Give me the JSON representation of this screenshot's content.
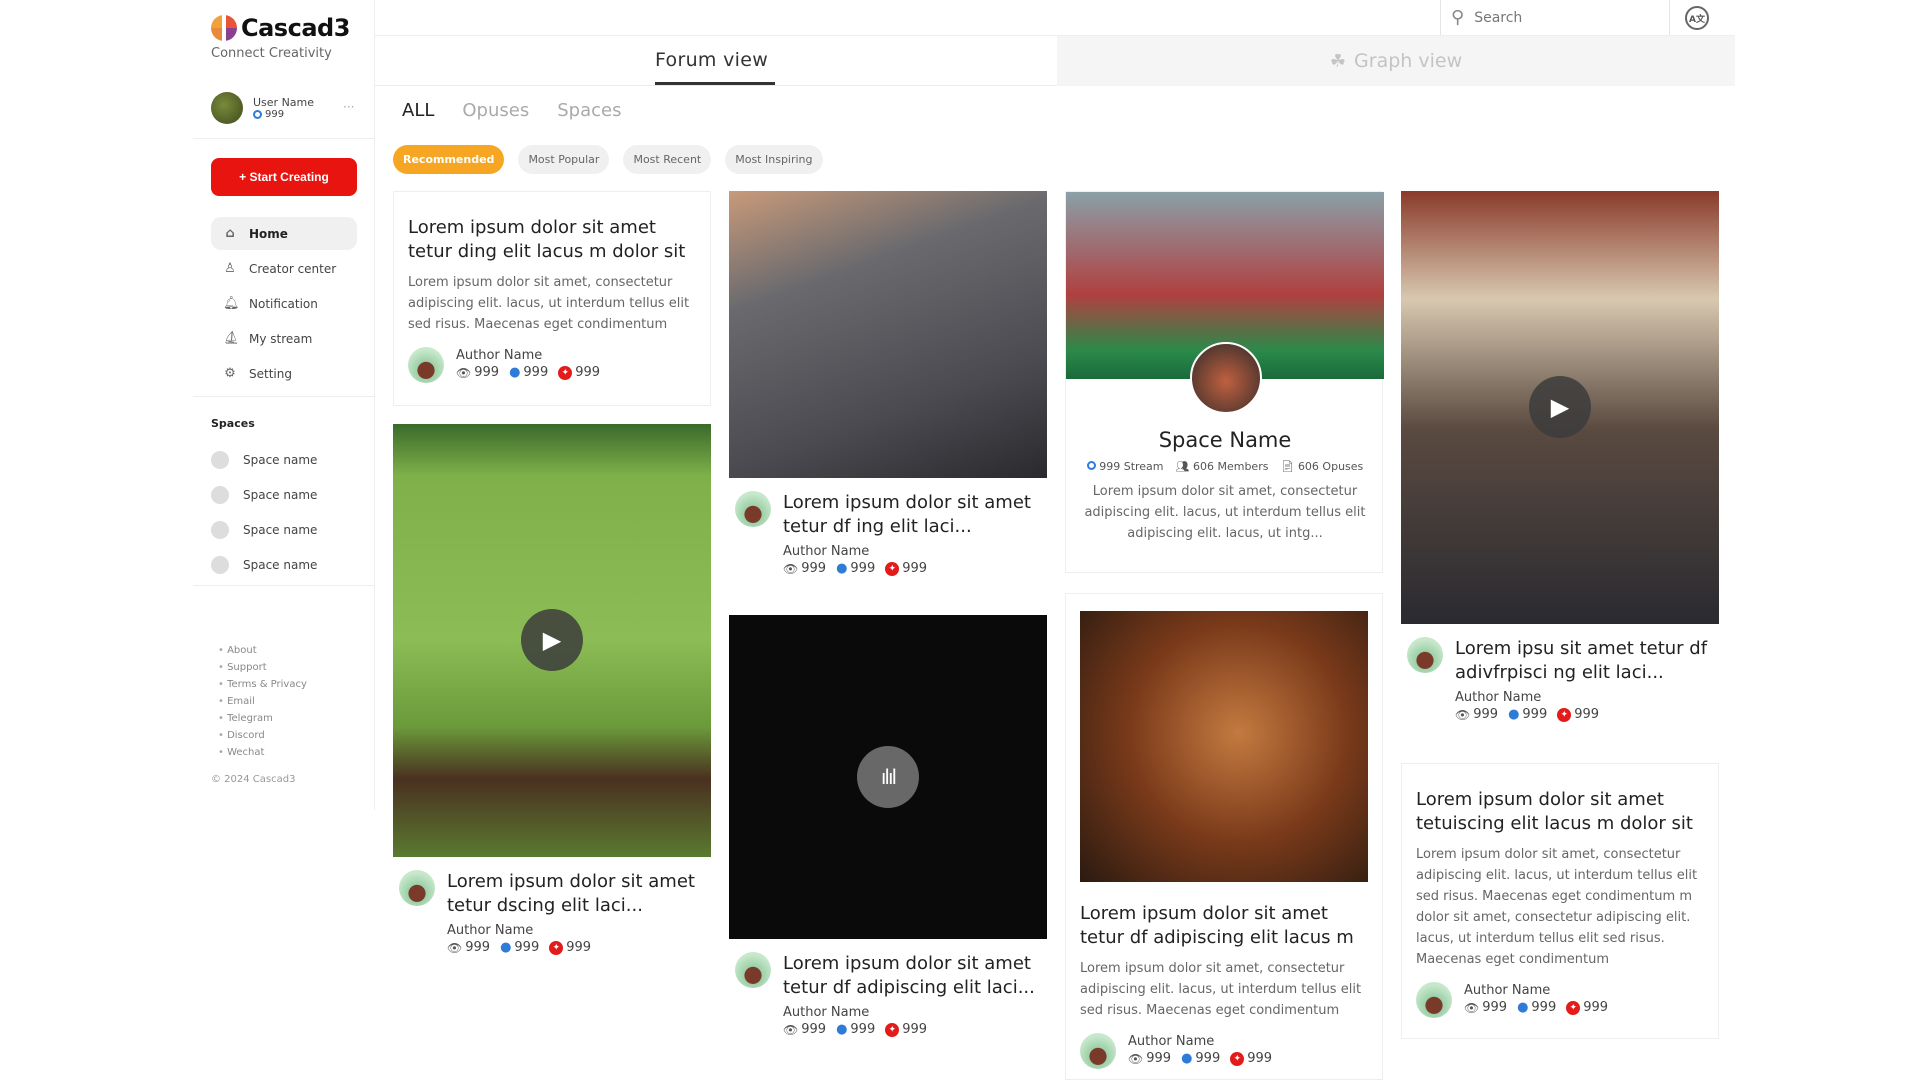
{
  "brand": {
    "name": "Cascad3",
    "tagline": "Connect Creativity"
  },
  "user": {
    "name": "User Name",
    "count": "999",
    "more": "···"
  },
  "start_button": "+ Start Creating",
  "nav": [
    {
      "label": "Home",
      "icon": "home-icon",
      "glyph": "⌂",
      "active": true
    },
    {
      "label": "Creator center",
      "icon": "user-icon",
      "glyph": "♙"
    },
    {
      "label": "Notification",
      "icon": "bell-icon",
      "glyph": "🔔︎"
    },
    {
      "label": "My stream",
      "icon": "stream-icon",
      "glyph": "⛵︎"
    },
    {
      "label": "Setting",
      "icon": "gear-icon",
      "glyph": "⚙"
    }
  ],
  "spaces": {
    "heading": "Spaces",
    "items": [
      "Space name",
      "Space name",
      "Space name",
      "Space name"
    ]
  },
  "footer": {
    "links": [
      "About",
      "Support",
      "Terms & Privacy",
      "Email",
      "Telegram",
      "Discord",
      "Wechat"
    ],
    "copyright": "© 2024 Cascad3"
  },
  "search": {
    "placeholder": "Search"
  },
  "lang_icon": "A文",
  "view_tabs": {
    "forum": "Forum view",
    "graph": "Graph view"
  },
  "content_tabs": [
    {
      "label": "ALL",
      "active": true
    },
    {
      "label": "Opuses"
    },
    {
      "label": "Spaces"
    }
  ],
  "chips": [
    {
      "label": "Recommended",
      "active": true
    },
    {
      "label": "Most Popular"
    },
    {
      "label": "Most Recent"
    },
    {
      "label": "Most Inspiring"
    }
  ],
  "colors": {
    "accent_red": "#e8140f",
    "chip_active": "#f6a623",
    "likes_blue": "#2f7bd8",
    "inspire_red": "#e31b1b"
  },
  "cards": {
    "c1": {
      "title": "Lorem ipsum dolor sit amet tetur ding elit lacus m dolor sit",
      "body": "Lorem ipsum dolor sit amet, consectetur adipiscing elit.  lacus, ut interdum tellus elit sed risus. Maecenas eget condimentum",
      "author": "Author Name",
      "views": "999",
      "likes": "999",
      "inspires": "999"
    },
    "c2": {
      "type": "video",
      "title": "Lorem ipsum dolor sit amet tetur dscing elit laci...",
      "author": "Author Name",
      "views": "999",
      "likes": "999",
      "inspires": "999"
    },
    "c3": {
      "type": "image",
      "title": "Lorem ipsum dolor sit amet tetur df ing elit laci...",
      "author": "Author Name",
      "views": "999",
      "likes": "999",
      "inspires": "999"
    },
    "c4": {
      "type": "audio",
      "title": "Lorem ipsum dolor sit amet tetur df adipiscing elit laci...",
      "author": "Author Name",
      "views": "999",
      "likes": "999",
      "inspires": "999"
    },
    "space": {
      "name": "Space Name",
      "stream": "999 Stream",
      "members": "606 Members",
      "opuses": "606 Opuses",
      "body": "Lorem ipsum dolor sit amet, consectetur adipiscing elit.  lacus, ut interdum tellus elit adipiscing elit.  lacus, ut intg..."
    },
    "c5": {
      "type": "image",
      "title": "Lorem ipsum dolor sit amet tetur df adipiscing elit lacus m",
      "body": "Lorem ipsum dolor sit amet, consectetur adipiscing elit.  lacus, ut interdum tellus elit sed risus. Maecenas eget condimentum",
      "author": "Author Name",
      "views": "999",
      "likes": "999",
      "inspires": "999"
    },
    "c6": {
      "type": "video",
      "title": "Lorem ipsu sit amet tetur df adivfrpisci ng elit laci...",
      "author": "Author Name",
      "views": "999",
      "likes": "999",
      "inspires": "999"
    },
    "c7": {
      "title": "Lorem ipsum dolor sit amet tetuiscing elit lacus m dolor sit",
      "body": "Lorem ipsum dolor sit amet, consectetur adipiscing elit.  lacus, ut interdum tellus elit sed risus. Maecenas eget condimentum m dolor sit amet, consectetur adipiscing elit. lacus, ut interdum tellus elit sed risus. Maecenas eget condimentum",
      "author": "Author Name",
      "views": "999",
      "likes": "999",
      "inspires": "999"
    }
  }
}
